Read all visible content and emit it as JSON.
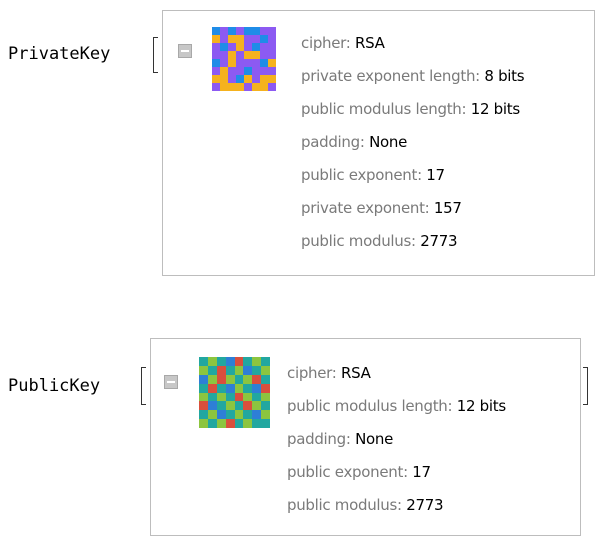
{
  "expressions": [
    {
      "head": "PrivateKey",
      "toggle_icon": "minus-box-icon",
      "swatch_colors": [
        "#8c5af2",
        "#f5b21e",
        "#1f8ce8"
      ],
      "swatch_cells": [
        2,
        0,
        2,
        0,
        2,
        2,
        0,
        0,
        1,
        0,
        1,
        1,
        0,
        0,
        2,
        0,
        0,
        2,
        0,
        1,
        0,
        2,
        0,
        0,
        0,
        0,
        1,
        0,
        1,
        1,
        0,
        0,
        2,
        0,
        1,
        0,
        0,
        0,
        2,
        1,
        0,
        1,
        0,
        0,
        2,
        0,
        0,
        0,
        1,
        1,
        0,
        2,
        1,
        0,
        1,
        1,
        0,
        1,
        1,
        1,
        0,
        1,
        1,
        0
      ],
      "fields": [
        {
          "label": "cipher: ",
          "value": "RSA"
        },
        {
          "label": "private exponent length: ",
          "value": "8 bits"
        },
        {
          "label": "public modulus length: ",
          "value": "12 bits"
        },
        {
          "label": "padding: ",
          "value": "None"
        },
        {
          "label": "public exponent: ",
          "value": "17"
        },
        {
          "label": "private exponent: ",
          "value": "157"
        },
        {
          "label": "public modulus: ",
          "value": "2773"
        }
      ]
    },
    {
      "head": "PublicKey",
      "toggle_icon": "minus-box-icon",
      "swatch_colors": [
        "#22a7a0",
        "#8cc53f",
        "#d94f3d",
        "#2e7fd6"
      ],
      "swatch_cells": [
        0,
        1,
        0,
        3,
        2,
        0,
        1,
        0,
        1,
        0,
        2,
        0,
        1,
        3,
        0,
        1,
        3,
        1,
        2,
        1,
        0,
        1,
        2,
        0,
        0,
        2,
        0,
        3,
        1,
        0,
        3,
        2,
        1,
        0,
        1,
        0,
        2,
        1,
        0,
        1,
        2,
        3,
        0,
        1,
        0,
        2,
        1,
        0,
        0,
        1,
        3,
        0,
        1,
        0,
        3,
        1,
        1,
        0,
        1,
        2,
        0,
        1,
        0,
        0
      ],
      "fields": [
        {
          "label": "cipher: ",
          "value": "RSA"
        },
        {
          "label": "public modulus length: ",
          "value": "12 bits"
        },
        {
          "label": "padding: ",
          "value": "None"
        },
        {
          "label": "public exponent: ",
          "value": "17"
        },
        {
          "label": "public modulus: ",
          "value": "2773"
        }
      ]
    }
  ]
}
